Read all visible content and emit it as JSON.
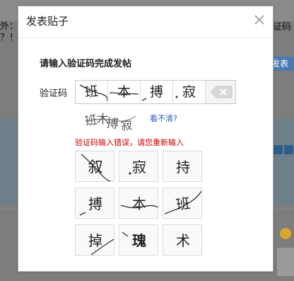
{
  "background": {
    "left_text_1": "外：",
    "left_text_2": "？！",
    "right_text": "证码",
    "right_button": "发表"
  },
  "dialog": {
    "title": "发表贴子",
    "close_label": "×",
    "prompt": "请输入验证码完成发帖",
    "code_label": "验证码",
    "entered_chars": [
      "班",
      "本",
      "搏",
      "寂"
    ],
    "backspace_label": "⌫",
    "captcha_chars": [
      "班",
      "木",
      "搏",
      "寂"
    ],
    "refresh_link": "看不清?",
    "error": "验证码输入错误，请您重新输入",
    "choices": [
      "叙",
      "寂",
      "持",
      "搏",
      "本",
      "班",
      "掉",
      "瑰",
      "术"
    ]
  },
  "colors": {
    "error_red": "#cc0000",
    "link_blue": "#2a5fb8",
    "overlay_gray": "#7d7d7d"
  }
}
